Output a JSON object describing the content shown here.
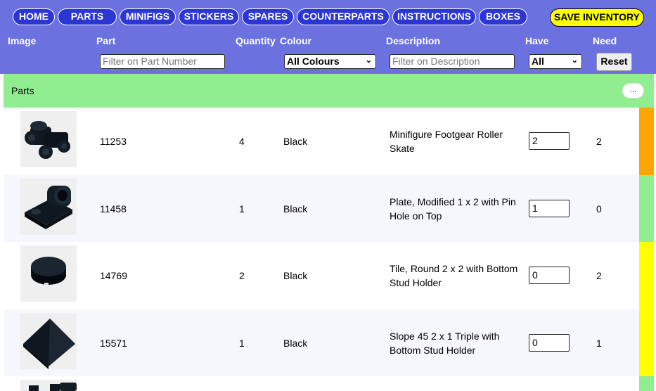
{
  "nav": {
    "items": [
      "HOME",
      "PARTS",
      "MINIFIGS",
      "STICKERS",
      "SPARES",
      "COUNTERPARTS",
      "INSTRUCTIONS",
      "BOXES"
    ],
    "save_label": "SAVE INVENTORY"
  },
  "headers": {
    "image": "Image",
    "part": "Part",
    "quantity": "Quantity",
    "colour": "Colour",
    "description": "Description",
    "have": "Have",
    "need": "Need"
  },
  "filters": {
    "part_placeholder": "Filter on Part Number",
    "colour_value": "All Colours",
    "description_placeholder": "Filter on Description",
    "have_value": "All",
    "reset_label": "Reset"
  },
  "group": {
    "title": "Parts",
    "more_label": "..."
  },
  "rows": [
    {
      "part": "11253",
      "quantity": "4",
      "colour": "Black",
      "description": "Minifigure Footgear Roller Skate",
      "have": "2",
      "need": "2",
      "status_color": "#ffa500",
      "icon": "roller-skate-part-icon"
    },
    {
      "part": "11458",
      "quantity": "1",
      "colour": "Black",
      "description": "Plate, Modified 1 x 2 with Pin Hole on Top",
      "have": "1",
      "need": "0",
      "status_color": "#90ee90",
      "icon": "plate-pin-hole-part-icon"
    },
    {
      "part": "14769",
      "quantity": "2",
      "colour": "Black",
      "description": "Tile, Round 2 x 2 with Bottom Stud Holder",
      "have": "0",
      "need": "2",
      "status_color": "#ffff00",
      "icon": "round-tile-part-icon"
    },
    {
      "part": "15571",
      "quantity": "1",
      "colour": "Black",
      "description": "Slope 45 2 x 1 Triple with Bottom Stud Holder",
      "have": "0",
      "need": "1",
      "status_color": "#ffff00",
      "icon": "slope-part-icon"
    }
  ]
}
